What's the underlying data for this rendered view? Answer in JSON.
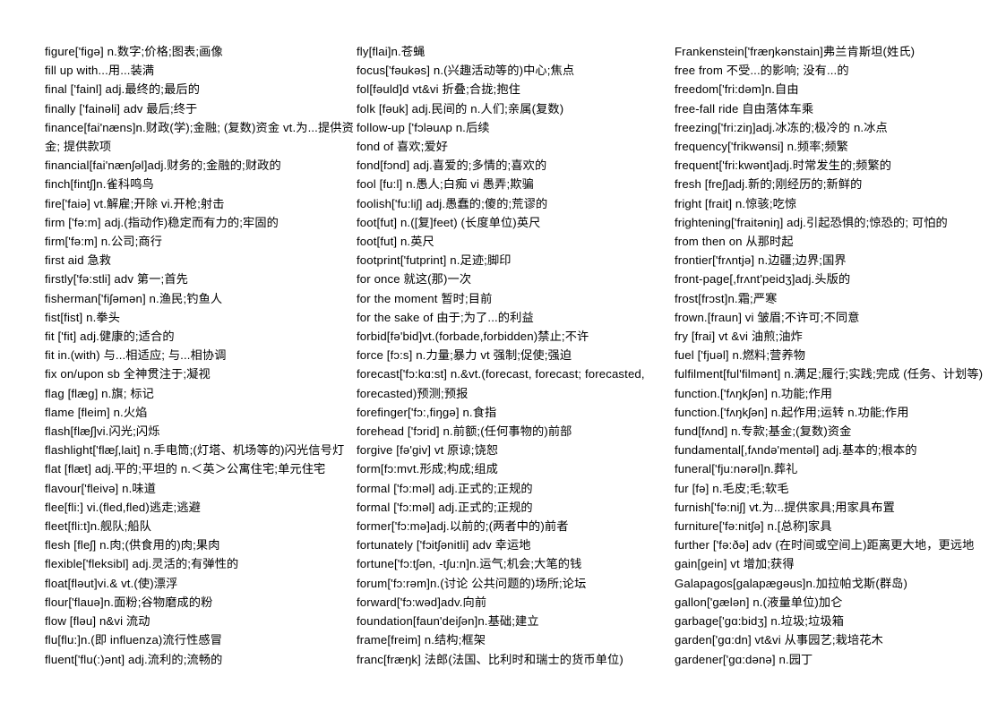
{
  "document": {
    "type": "vocabulary-word-list",
    "layout": "three-column",
    "letter_range": "fi - ga"
  },
  "columns": [
    {
      "name": "column-1",
      "entries": [
        "figure['figə] n.数字;价格;图表;画像",
        "fill up with...用...装满",
        "final ['fainl] adj.最终的;最后的",
        "finally ['fainəli] adv 最后;终于",
        "finance[fai'næns]n.财政(学);金融; (复数)资金  vt.为...提供资金; 提供款项",
        "financial[fai'nænʃəl]adj.财务的;金融的;财政的",
        "finch[fintʃ]n.雀科鸣鸟",
        "fire['faiə] vt.解雇;开除  vi.开枪;射击",
        "firm ['fə:m] adj.(指动作)稳定而有力的;牢固的",
        "firm['fə:m] n.公司;商行",
        "first aid 急救",
        "firstly['fə:stli] adv 第一;首先",
        "fisherman['fiʃəmən] n.渔民;钓鱼人",
        "fist[fist] n.拳头",
        "fit ['fit] adj.健康的;适合的",
        "fit in.(with) 与...相适应; 与...相协调",
        "fix on/upon sb 全神贯注于;凝视",
        "flag [flæg] n.旗; 标记",
        "flame [fleim] n.火焰",
        "flash[flæʃ]vi.闪光;闪烁",
        "flashlight['flæʃ,lait] n.手电筒;(灯塔、机场等的)闪光信号灯",
        "flat [flæt] adj.平的;平坦的  n.＜英＞公寓住宅;单元住宅",
        "flavour['fleivə] n.味道",
        "flee[fli:] vi.(fled,fled)逃走;逃避",
        "fleet[fli:t]n.舰队;船队",
        "flesh [fleʃ] n.肉;(供食用的)肉;果肉",
        "flexible['fleksibl] adj.灵活的;有弹性的",
        "float[fləut]vi.& vt.(使)漂浮",
        "flour['flauə]n.面粉;谷物磨成的粉",
        "flow [fləu] n&vi 流动",
        "flu[flu:]n.(即 influenza)流行性感冒",
        "fluent['flu(:)ənt] adj.流利的;流畅的"
      ]
    },
    {
      "name": "column-2",
      "entries": [
        "fly[flai]n.苍蝇",
        "focus['fəukəs] n.(兴趣活动等的)中心;焦点",
        "fol[fəuld]d vt&vi 折叠;合拢;抱住",
        "folk [fəuk] adj.民间的  n.人们;亲属(复数)",
        "follow-up ['fɔləuʌp n.后续",
        "fond of 喜欢;爱好",
        "fond[fɔnd] adj.喜爱的;多情的;喜欢的",
        "fool [fu:l] n.愚人;白痴  vi 愚弄;欺骗",
        "foolish['fu:liʃ] adj.愚蠢的;傻的;荒谬的",
        "foot[fut] n.([复]feet) (长度单位)英尺",
        "foot[fut] n.英尺",
        "footprint['futprint] n.足迹;脚印",
        "for once 就这(那)一次",
        "for the moment 暂时;目前",
        "for the sake of 由于;为了...的利益",
        "forbid[fə'bid]vt.(forbade,forbidden)禁止;不许",
        "force [fɔ:s] n.力量;暴力  vt 强制;促使;强迫",
        "forecast['fɔ:kɑ:st]  n.&vt.(forecast, forecast; forecasted, forecasted)预测;预报",
        "forefinger['fɔ:,fiŋgə] n.食指",
        "forehead ['fɔrid] n.前额;(任何事物的)前部",
        "forgive [fə'giv] vt 原谅;饶恕",
        "form[fɔ:mvt.形成;构成;组成",
        "formal ['fɔ:məl] adj.正式的;正规的",
        "formal ['fɔ:məl] adj.正式的;正规的",
        "former['fɔ:mə]adj.以前的;(两者中的)前者",
        "fortunately ['fɔitʃənitli] adv 幸运地",
        "fortune['fɔ:tʃən, -tʃu:n]n.运气;机会;大笔的钱",
        "forum['fɔ:rəm]n.(讨论 公共问题的)场所;论坛",
        "forward['fɔ:wəd]adv.向前",
        "foundation[faun'deiʃən]n.基础;建立",
        "frame[freim] n.结构;框架",
        "franc[fræŋk] 法郎(法国、比利时和瑞士的货币单位)"
      ]
    },
    {
      "name": "column-3",
      "entries": [
        "Frankenstein['fræŋkənstain]弗兰肯斯坦(姓氏)",
        "free from 不受...的影响; 没有...的",
        "freedom['fri:dəm]n.自由",
        "free-fall ride 自由落体车乘",
        "freezing['fri:ziŋ]adj.冰冻的;极冷的  n.冰点",
        "frequency['frikwənsi] n.频率;频繁",
        "frequent['fri:kwənt]adj.时常发生的;频繁的",
        "fresh [freʃ]adj.新的;刚经历的;新鲜的",
        "fright [frait] n.惊骇;吃惊",
        "frightening['fraitəniŋ] adj.引起恐惧的;惊恐的; 可怕的",
        "from then on 从那时起",
        "frontier['frʌntjə] n.边疆;边界;国界",
        "front-page[,frʌnt'peidʒ]adj.头版的",
        "frost[frɔst]n.霜;严寒",
        "frown.[fraun] vi 皱眉;不许可;不同意",
        "fry [frai] vt &vi 油煎;油炸",
        "fuel ['fjuəl] n.燃料;营养物",
        "fulfilment[ful'filmənt] n.满足;履行;实践;完成 (任务、计划等)",
        "function.['fʌŋkʃən] n.功能;作用",
        "function.['fʌŋkʃən] n.起作用;运转  n.功能;作用",
        "fund[fʌnd] n.专款;基金;(复数)资金",
        "fundamental[,fʌndə'mentəl] adj.基本的;根本的",
        "funeral['fju:nərəl]n.葬礼",
        "fur [fə] n.毛皮;毛;软毛",
        "furnish['fə:niʃ] vt.为...提供家具;用家具布置",
        "furniture['fə:nitʃə] n.[总称]家具",
        "further ['fə:ðə] adv (在时间或空间上)距离更大地，更远地",
        "gain[gein] vt 增加;获得",
        "Galapagos[galapægəus]n.加拉帕戈斯(群岛)",
        "gallon['gælən] n.(液量单位)加仑",
        "garbage['gɑ:bidʒ] n.垃圾;垃圾箱",
        "garden['gɑ:dn] vt&vi 从事园艺;栽培花木",
        "gardener['gɑ:dənə] n.园丁"
      ]
    }
  ]
}
